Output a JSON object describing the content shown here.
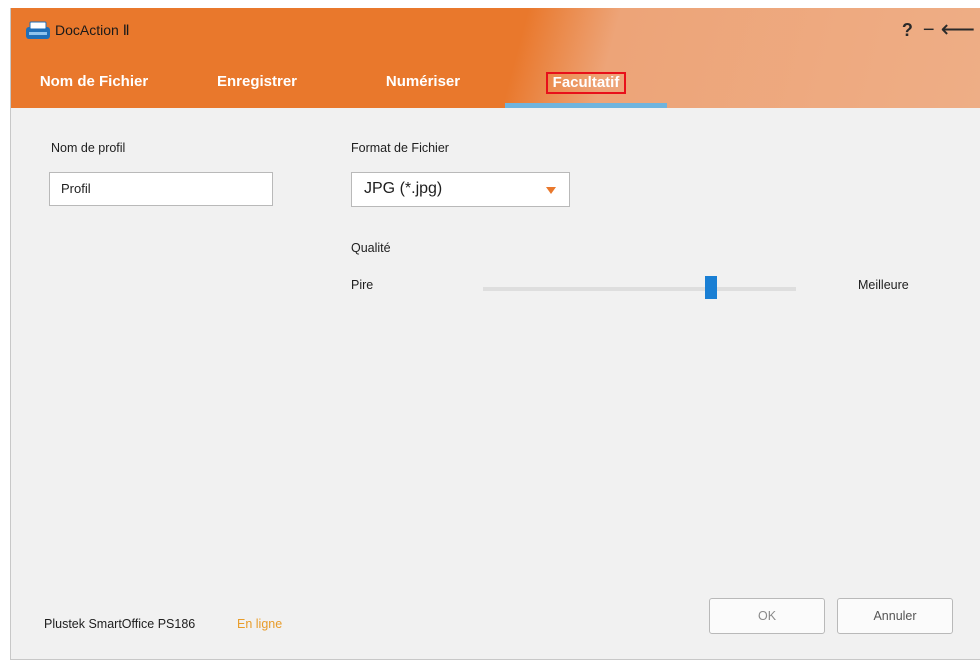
{
  "window": {
    "title": "DocAction Ⅱ",
    "icon": "scanner-icon",
    "controls": {
      "help": "?",
      "minimize": "−",
      "back": "⟵"
    }
  },
  "tabs": [
    {
      "label": "Nom de Fichier",
      "active": false
    },
    {
      "label": "Enregistrer",
      "active": false
    },
    {
      "label": "Numériser",
      "active": false
    },
    {
      "label": "Facultatif",
      "active": true
    }
  ],
  "form": {
    "profile_label": "Nom de profil",
    "profile_value": "Profil",
    "format_label": "Format de Fichier",
    "format_value": "JPG (*.jpg)",
    "quality_label": "Qualité",
    "quality_min_label": "Pire",
    "quality_max_label": "Meilleure",
    "quality_level": 0.73
  },
  "footer": {
    "device_name": "Plustek SmartOffice PS186",
    "status": "En ligne",
    "ok_label": "OK",
    "cancel_label": "Annuler"
  },
  "colors": {
    "header_orange": "#e9782c",
    "active_tab_underline": "#6fb4de",
    "highlight_box": "#e8101a",
    "slider_thumb": "#1a7fd4",
    "status_online": "#e89c2a"
  }
}
